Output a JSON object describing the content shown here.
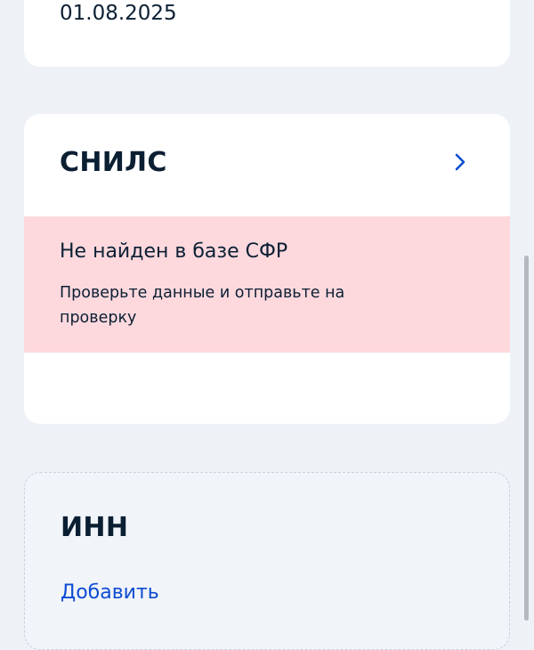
{
  "date_card": {
    "date": "01.08.2025"
  },
  "snils_card": {
    "title": "СНИЛС",
    "chevron_icon": "chevron-right-icon",
    "alert": {
      "title": "Не найден в базе СФР",
      "text": "Проверьте данные и отправьте на проверку",
      "background": "#fdd9de"
    }
  },
  "inn_card": {
    "title": "ИНН",
    "add_label": "Добавить",
    "link_color": "#0d4cd3"
  },
  "colors": {
    "page_background": "#eef2f7",
    "card_background": "#ffffff",
    "text": "#0b1f33"
  }
}
